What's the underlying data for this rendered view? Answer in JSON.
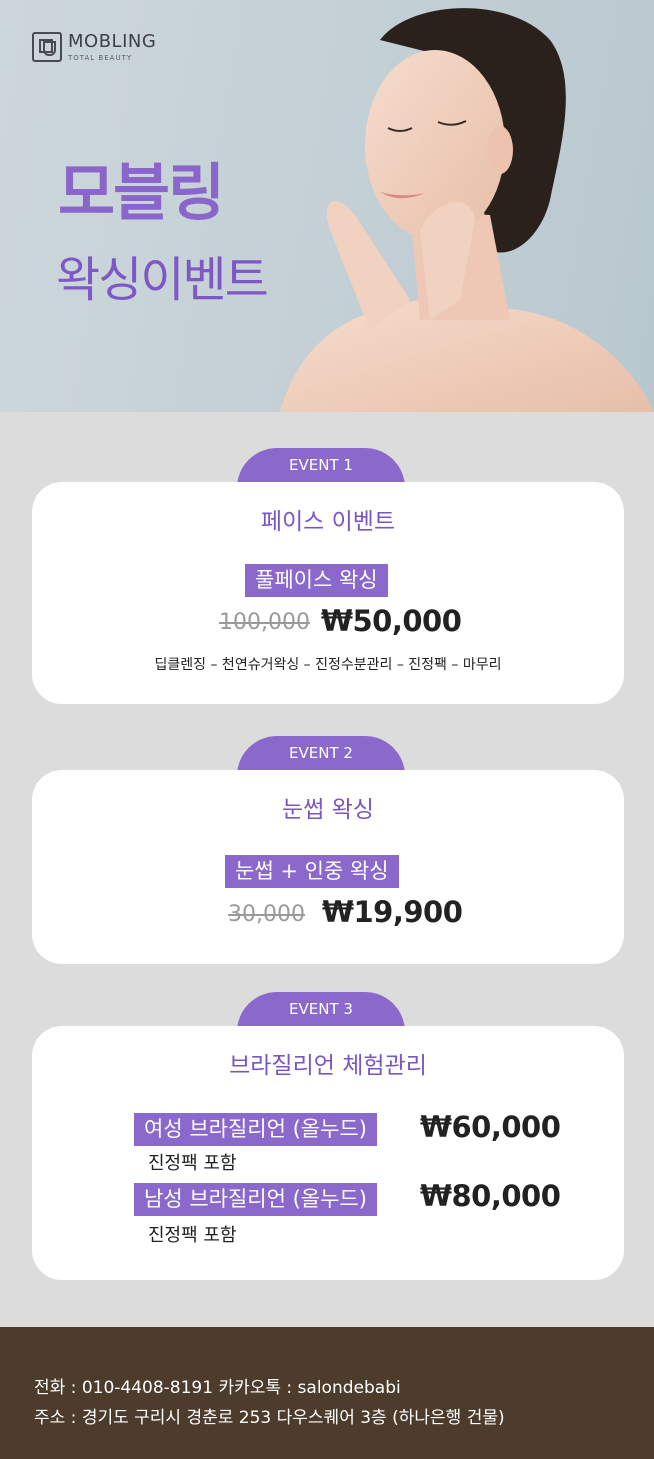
{
  "brand": {
    "name": "MOBLING",
    "tagline": "TOTAL BEAUTY"
  },
  "hero": {
    "title_line1": "모블링",
    "title_line2": "왁싱이벤트"
  },
  "events": [
    {
      "tab": "EVENT 1",
      "title": "페이스 이벤트",
      "tag": "풀페이스 왁싱",
      "old_price": "100,000",
      "new_price": "₩50,000",
      "description": "딥클렌징 – 천연슈거왁싱 – 진정수분관리 – 진정팩 – 마무리"
    },
    {
      "tab": "EVENT 2",
      "title": "눈썹 왁싱",
      "tag": "눈썹 + 인중 왁싱",
      "old_price": "30,000",
      "new_price": "₩19,900"
    },
    {
      "tab": "EVENT 3",
      "title": "브라질리언 체험관리",
      "items": [
        {
          "tag": "여성 브라질리언 (올누드)",
          "price": "₩60,000",
          "note": "진정팩 포함"
        },
        {
          "tag": "남성 브라질리언 (올누드)",
          "price": "₩80,000",
          "note": "진정팩 포함"
        }
      ]
    }
  ],
  "footer": {
    "line1": "전화 : 010-4408-8191  카카오톡 : salondebabi",
    "line2": "주소 : 경기도 구리시 경춘로 253 다우스퀘어 3층 (하나은행 건물)"
  },
  "colors": {
    "accent": "#8a68cc",
    "footer_bg": "#4d3c2c",
    "background": "#dcdcdc"
  }
}
